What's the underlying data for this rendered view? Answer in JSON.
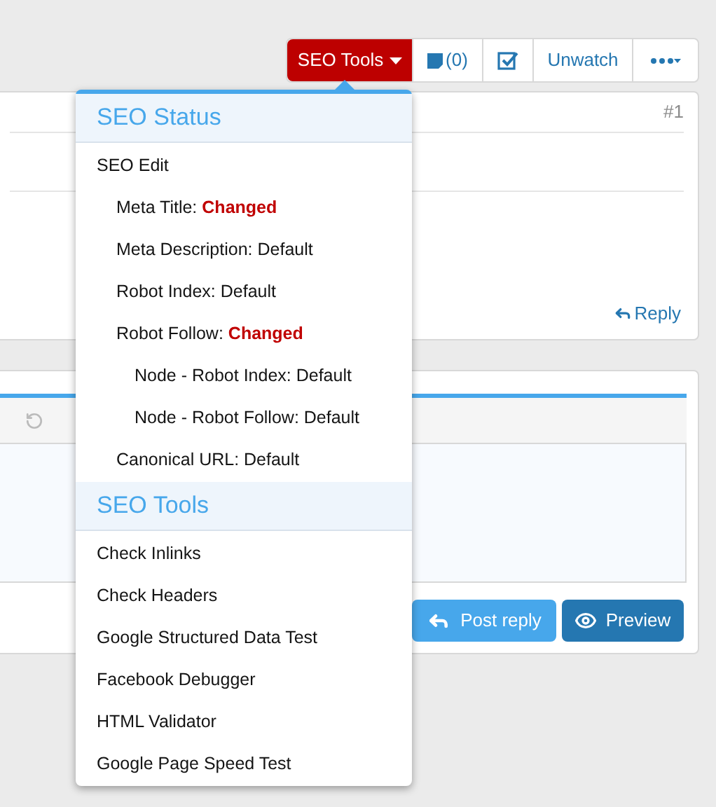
{
  "toolbar": {
    "buttons": [
      {
        "kind": "seo",
        "label": "SEO Tools"
      },
      {
        "kind": "comments",
        "label": "(0)"
      },
      {
        "kind": "check"
      },
      {
        "kind": "text",
        "label": "Unwatch"
      },
      {
        "kind": "more"
      }
    ]
  },
  "post": {
    "number": "#1",
    "reply": "Reply"
  },
  "editor": {
    "buttons": [
      {
        "kind": "post",
        "label": "Post reply"
      },
      {
        "kind": "preview",
        "label": "Preview"
      }
    ]
  },
  "dropdown": {
    "open": true,
    "sections": [
      {
        "title": "SEO Status",
        "items": [
          {
            "label": "SEO Edit",
            "children": [
              {
                "label": "Meta Title:",
                "value": "Changed",
                "changed": true
              },
              {
                "label": "Meta Description:",
                "value": "Default",
                "changed": false
              },
              {
                "label": "Robot Index:",
                "value": "Default",
                "changed": false
              },
              {
                "label": "Robot Follow:",
                "value": "Changed",
                "changed": true,
                "children": [
                  {
                    "label": "Node - Robot Index:",
                    "value": "Default",
                    "changed": false
                  },
                  {
                    "label": "Node - Robot Follow:",
                    "value": "Default",
                    "changed": false
                  }
                ]
              },
              {
                "label": "Canonical URL:",
                "value": "Default",
                "changed": false
              }
            ]
          }
        ]
      },
      {
        "title": "SEO Tools",
        "items": [
          {
            "label": "Check Inlinks"
          },
          {
            "label": "Check Headers"
          },
          {
            "label": "Google Structured Data Test"
          },
          {
            "label": "Facebook Debugger"
          },
          {
            "label": "HTML Validator"
          },
          {
            "label": "Google Page Speed Test"
          }
        ]
      }
    ]
  }
}
